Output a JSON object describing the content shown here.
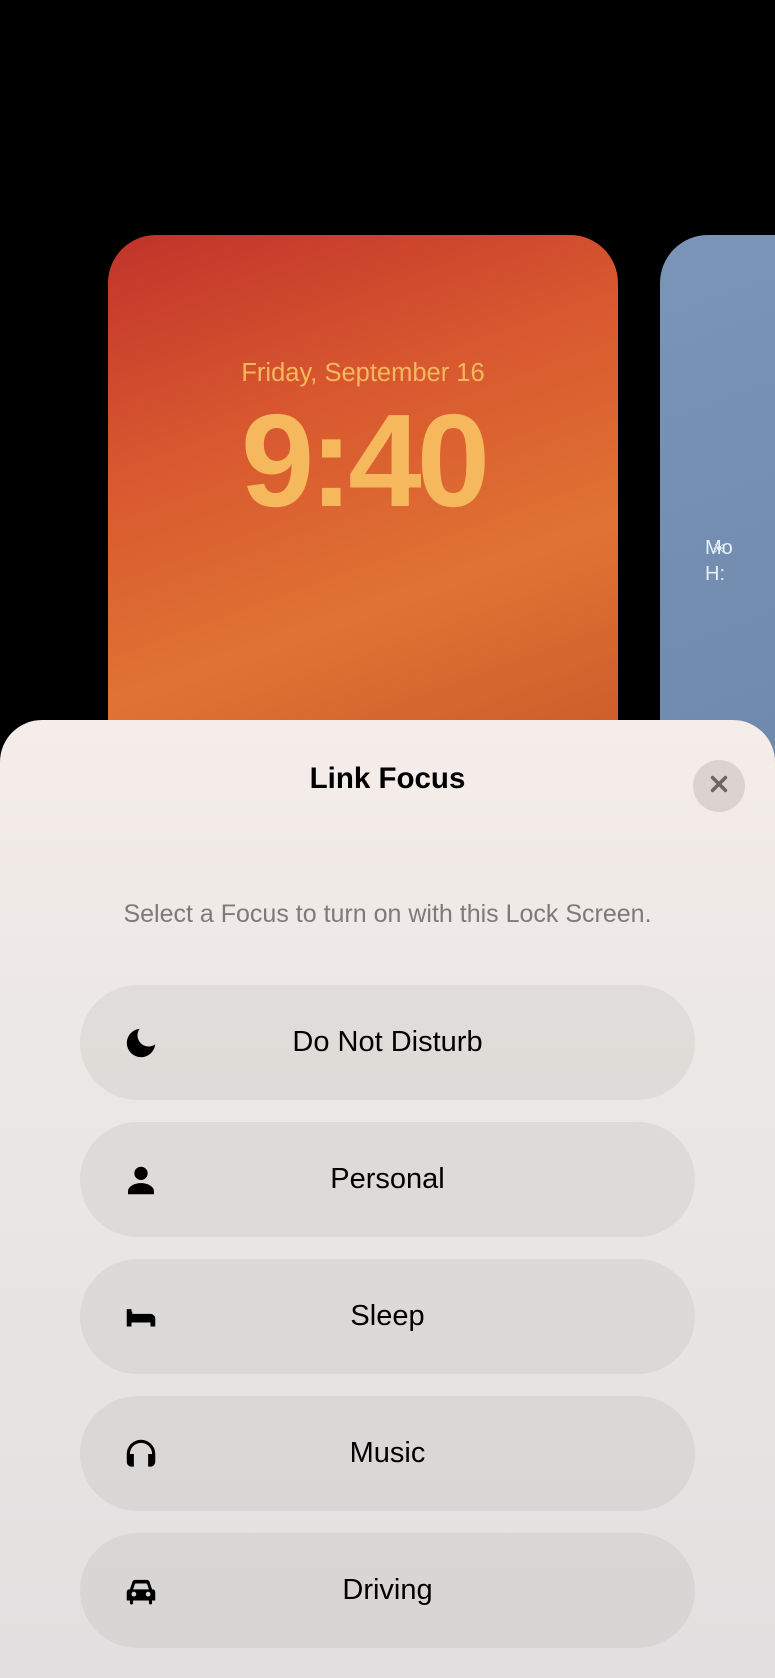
{
  "wallpaper": {
    "date": "Friday, September 16",
    "time": "9:40",
    "next_preview": {
      "line1": "Mo",
      "line2": "H:"
    }
  },
  "sheet": {
    "title": "Link Focus",
    "subtitle": "Select a Focus to turn on with this Lock Screen.",
    "items": [
      {
        "label": "Do Not Disturb",
        "icon": "moon"
      },
      {
        "label": "Personal",
        "icon": "person"
      },
      {
        "label": "Sleep",
        "icon": "bed"
      },
      {
        "label": "Music",
        "icon": "headphones"
      },
      {
        "label": "Driving",
        "icon": "car"
      }
    ]
  }
}
